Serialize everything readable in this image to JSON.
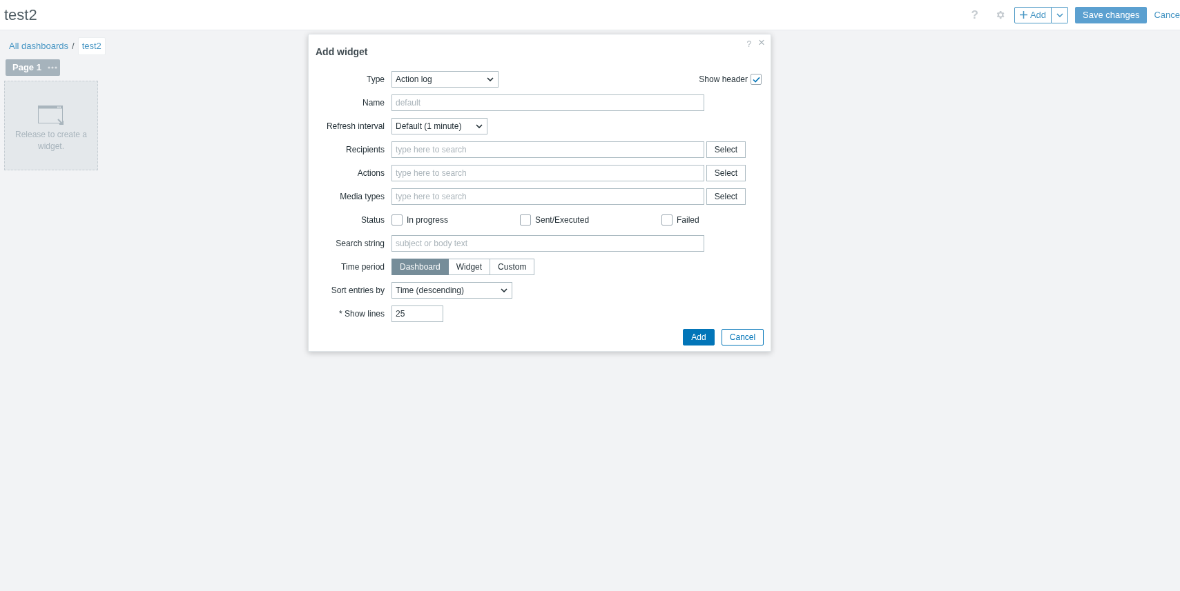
{
  "header": {
    "title": "test2",
    "help": "?",
    "add_button": "Add",
    "save_button": "Save changes",
    "cancel_link": "Cance"
  },
  "breadcrumbs": [
    {
      "label": "All dashboards",
      "selected": false
    },
    {
      "label": "test2",
      "selected": true
    }
  ],
  "breadcrumb_separator": "/",
  "page_tabs": [
    {
      "label": "Page 1",
      "selected": true
    }
  ],
  "placeholder_widget": {
    "text": "Release to create a widget."
  },
  "dialog": {
    "title": "Add widget",
    "help": "?",
    "close": "×",
    "fields": [
      {
        "kind": "select",
        "label": "Type",
        "value": "Action log"
      },
      {
        "kind": "text",
        "label": "Name",
        "placeholder": "default"
      },
      {
        "kind": "select",
        "label": "Refresh interval",
        "value": "Default (1 minute)"
      },
      {
        "kind": "multiselect",
        "label": "Recipients",
        "placeholder": "type here to search",
        "button": "Select"
      },
      {
        "kind": "multiselect",
        "label": "Actions",
        "placeholder": "type here to search",
        "button": "Select"
      },
      {
        "kind": "multiselect",
        "label": "Media types",
        "placeholder": "type here to search",
        "button": "Select"
      },
      {
        "kind": "checkboxes",
        "label": "Status",
        "options": [
          {
            "label": "In progress",
            "checked": false
          },
          {
            "label": "Sent/Executed",
            "checked": false
          },
          {
            "label": "Failed",
            "checked": false
          }
        ]
      },
      {
        "kind": "text",
        "label": "Search string",
        "placeholder": "subject or body text"
      },
      {
        "kind": "segmented",
        "label": "Time period",
        "options": [
          {
            "label": "Dashboard",
            "selected": true
          },
          {
            "label": "Widget",
            "selected": false
          },
          {
            "label": "Custom",
            "selected": false
          }
        ]
      },
      {
        "kind": "select",
        "label": "Sort entries by",
        "value": "Time (descending)"
      },
      {
        "kind": "number",
        "label": "* Show lines",
        "value": "25"
      }
    ],
    "show_header": {
      "label": "Show header",
      "checked": true
    },
    "buttons": [
      {
        "label": "Add",
        "kind": "primary"
      },
      {
        "label": "Cancel",
        "kind": "secondary"
      }
    ]
  }
}
